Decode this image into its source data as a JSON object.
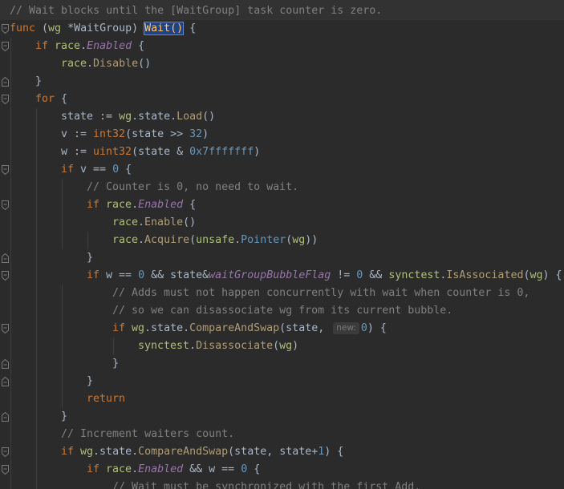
{
  "code": {
    "doc_comment": "// Wait blocks until the [WaitGroup] task counter is zero.",
    "kw_func": "func",
    "open_paren": " (",
    "receiver_name": "wg",
    "receiver_type": " *WaitGroup)",
    "method_name": "Wait()",
    "brace_open": " {",
    "kw_if": "if",
    "kw_for": "for",
    "kw_return": "return",
    "pkg_race": "race",
    "pkg_unsafe": "unsafe",
    "pkg_synctest": "synctest",
    "pkg_wg": "wg",
    "field_enabled": "Enabled",
    "field_bubble_flag": "waitGroupBubbleFlag",
    "dot": ".",
    "space_brace": " {",
    "brace_close": "}",
    "m_disable": "Disable",
    "m_enable": "Enable",
    "m_acquire": "Acquire",
    "m_load": "Load",
    "m_cas": "CompareAndSwap",
    "m_is_associated": "IsAssociated",
    "m_disassociate": "Disassociate",
    "m_pointer": "Pointer",
    "parens_empty": "()",
    "paren_open": "(",
    "paren_close": ")",
    "paren_close2": "))",
    "paren_close_brace": ") {",
    "state_assign": "state := ",
    "state_field": ".state.",
    "v_assign": "v := ",
    "w_assign": "w := ",
    "t_int32": "int32",
    "t_uint32": "uint32",
    "state_shift": "(state >> ",
    "n32": "32",
    "state_and": "(state & ",
    "hex_mask": "0x7fffffff",
    "v_eq": " v == ",
    "w_eq": " w == ",
    "and_state": " && state&",
    "neq": " != ",
    "and_op": " && ",
    "zero": "0",
    "one": "1",
    "cm_counter_zero": "// Counter is 0, no need to wait.",
    "cm_adds_must": "// Adds must not happen concurrently with wait when counter is 0,",
    "cm_so_we": "// so we can disassociate wg from its current bubble.",
    "cm_increment": "// Increment waiters count.",
    "cm_wait_must": "// Wait must be synchronized with the first Add.",
    "cas_args1": "(state, ",
    "hint_new": "new:",
    "cas_args2": "(state, state+",
    "and_w": " && w == "
  }
}
